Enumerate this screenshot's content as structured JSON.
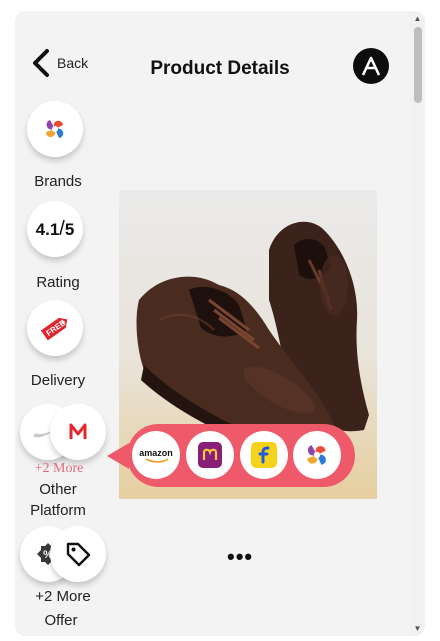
{
  "header": {
    "back_label": "Back",
    "title": "Product Details"
  },
  "sidebar": {
    "brands_label": "Brands",
    "rating_value": "4.1",
    "rating_max": "5",
    "rating_label": "Rating",
    "delivery_badge": "FREE",
    "delivery_label": "Delivery",
    "platform_more": "+2 More",
    "platform_label_1": "Other",
    "platform_label_2": "Platform",
    "offer_more": "+2 More",
    "offer_label": "Offer",
    "percent_glyph": "%"
  },
  "popup": {
    "amazon_text": "amazon"
  },
  "more_dots": "•••",
  "colors": {
    "accent": "#ef5a6a",
    "more_text": "#e46a7a",
    "background": "#f3f3f3"
  }
}
